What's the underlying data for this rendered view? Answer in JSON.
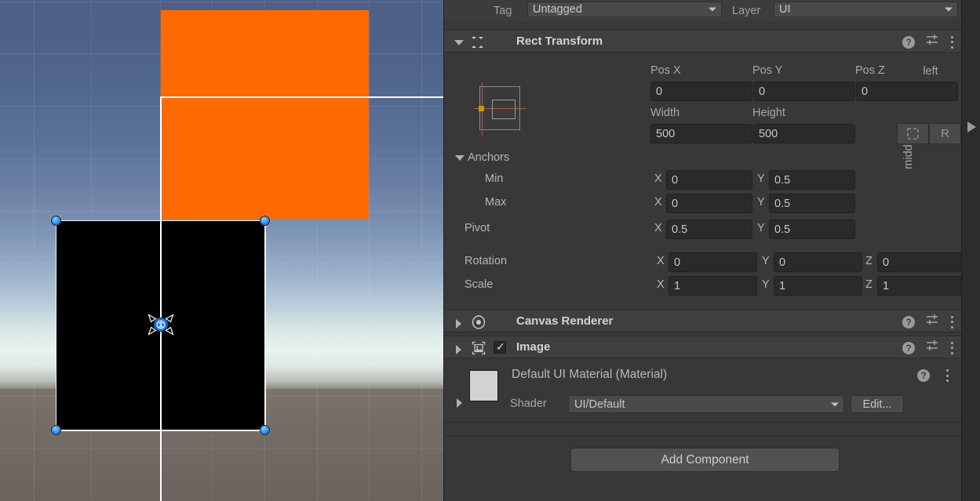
{
  "scene": {
    "view_name": "scene-view",
    "background_top_color": "#4d6186",
    "background_horizon_color": "#e9f3ef",
    "ground_color": "#7b736c",
    "orange_rect_color": "#ff6a00",
    "selected_rect_color": "#000000",
    "handle_color": "#3f9ef5",
    "gizmo_name": "move-tool-gizmo",
    "canvas_edge_color": "#ffffff"
  },
  "inspector": {
    "tag_label": "Tag",
    "tag_value": "Untagged",
    "layer_label": "Layer",
    "layer_value": "UI",
    "components": [
      {
        "name": "Rect Transform",
        "icon": "rect-transform-icon",
        "expanded": true
      },
      {
        "name": "Canvas Renderer",
        "icon": "canvas-renderer-icon",
        "expanded": false
      },
      {
        "name": "Image",
        "icon": "image-component-icon",
        "expanded": false,
        "enabled": true
      }
    ],
    "rect_transform": {
      "anchor_preset_horizontal": "left",
      "anchor_preset_vertical": "middle",
      "pos_x_label": "Pos X",
      "pos_x_value": "0",
      "pos_y_label": "Pos Y",
      "pos_y_value": "0",
      "pos_z_label": "Pos Z",
      "pos_z_value": "0",
      "width_label": "Width",
      "width_value": "500",
      "height_label": "Height",
      "height_value": "500",
      "blueprint_toggle": "",
      "raw_toggle": "R",
      "anchors_label": "Anchors",
      "min_label": "Min",
      "min_x": "0",
      "min_y": "0.5",
      "max_label": "Max",
      "max_x": "0",
      "max_y": "0.5",
      "pivot_label": "Pivot",
      "pivot_x": "0.5",
      "pivot_y": "0.5",
      "rotation_label": "Rotation",
      "rotation_x": "0",
      "rotation_y": "0",
      "rotation_z": "0",
      "scale_label": "Scale",
      "scale_x": "1",
      "scale_y": "1",
      "scale_z": "1",
      "axis_x": "X",
      "axis_y": "Y",
      "axis_z": "Z"
    },
    "material": {
      "title": "Default UI Material (Material)",
      "shader_label": "Shader",
      "shader_value": "UI/Default",
      "edit_label": "Edit...",
      "swatch_color": "#d2d2d2"
    },
    "add_component_label": "Add Component",
    "help_icon": "?",
    "icons": {
      "help": "help-icon",
      "preset": "preset-icon",
      "kebab": "kebab-menu-icon"
    }
  }
}
